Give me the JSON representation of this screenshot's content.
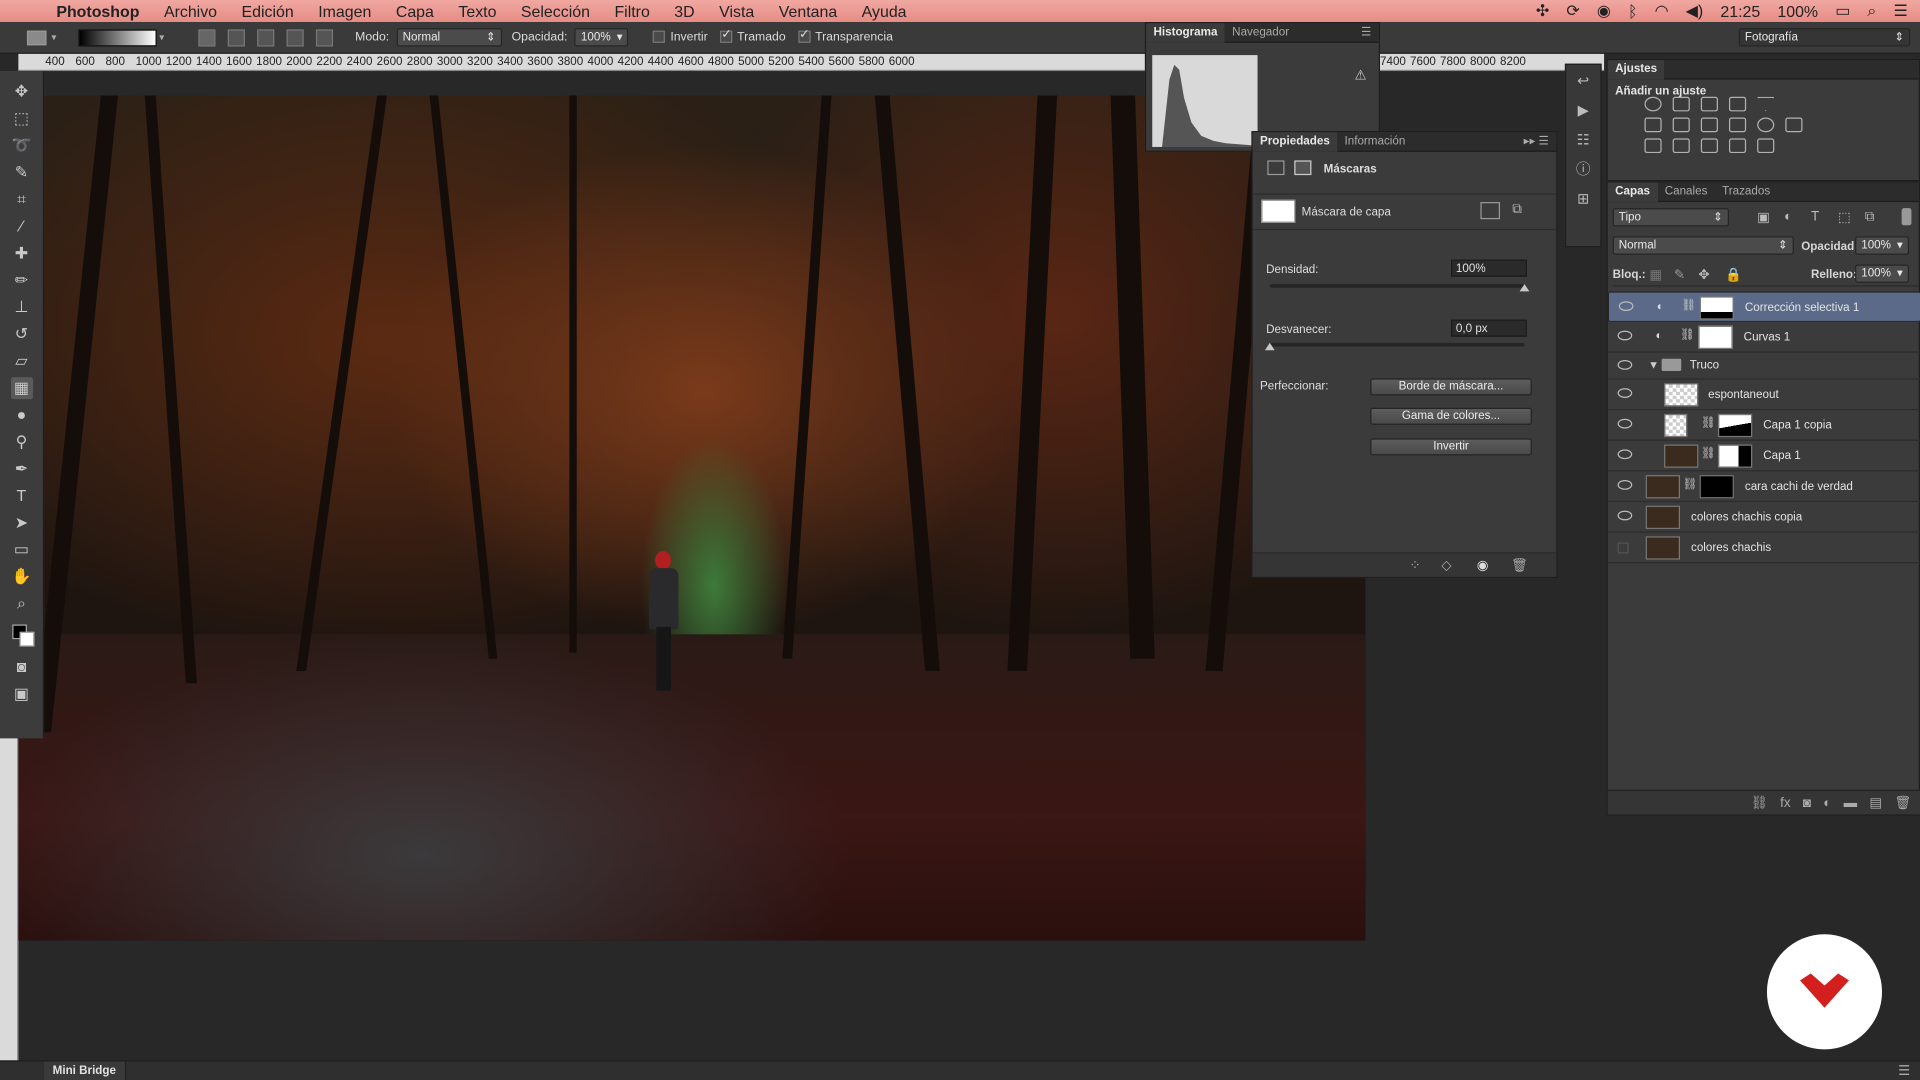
{
  "menubar": {
    "app": "Photoshop",
    "items": [
      "Archivo",
      "Edición",
      "Imagen",
      "Capa",
      "Texto",
      "Selección",
      "Filtro",
      "3D",
      "Vista",
      "Ventana",
      "Ayuda"
    ],
    "clock": "21:25",
    "battery": "100%"
  },
  "options": {
    "mode_label": "Modo:",
    "mode_value": "Normal",
    "opacity_label": "Opacidad:",
    "opacity_value": "100%",
    "invert_label": "Invertir",
    "dither_label": "Tramado",
    "transparency_label": "Transparencia",
    "workspace": "Fotografía"
  },
  "ruler_ticks": [
    "400",
    "600",
    "800",
    "1000",
    "1200",
    "1400",
    "1600",
    "1800",
    "2000",
    "2200",
    "2400",
    "2600",
    "2800",
    "3000",
    "3200",
    "3400",
    "3600",
    "3800",
    "4000",
    "4200",
    "4400",
    "4600",
    "4800",
    "5000",
    "5200",
    "5400",
    "5600",
    "5800",
    "6000"
  ],
  "ruler_ticks_right": [
    "7400",
    "7600",
    "7800",
    "8000",
    "8200"
  ],
  "histogram": {
    "tab_active": "Histograma",
    "tab_other": "Navegador"
  },
  "properties": {
    "tab_active": "Propiedades",
    "tab_other": "Información",
    "section": "Máscaras",
    "mask_type": "Máscara de capa",
    "density_label": "Densidad:",
    "density_value": "100%",
    "density_level": 1.0,
    "feather_label": "Desvanecer:",
    "feather_value": "0,0 px",
    "feather_level": 0.0,
    "refine_label": "Perfeccionar:",
    "btn_mask_edge": "Borde de máscara...",
    "btn_color_range": "Gama de colores...",
    "btn_invert": "Invertir"
  },
  "adjustments": {
    "title": "Ajustes",
    "subtitle": "Añadir un ajuste"
  },
  "layers": {
    "tabs": [
      "Capas",
      "Canales",
      "Trazados"
    ],
    "filter": "Tipo",
    "blend": "Normal",
    "opacity_label": "Opacidad:",
    "opacity_value": "100%",
    "lock_label": "Bloq.:",
    "fill_label": "Relleno:",
    "fill_value": "100%",
    "items": [
      {
        "name": "Corrección selectiva 1",
        "selected": true,
        "visible": true
      },
      {
        "name": "Curvas 1",
        "selected": false,
        "visible": true
      },
      {
        "name": "Truco",
        "selected": false,
        "visible": true
      },
      {
        "name": "espontaneout",
        "selected": false,
        "visible": true
      },
      {
        "name": "Capa 1 copia",
        "selected": false,
        "visible": true
      },
      {
        "name": "Capa 1",
        "selected": false,
        "visible": true
      },
      {
        "name": "cara cachi de verdad",
        "selected": false,
        "visible": true
      },
      {
        "name": "colores chachis copia",
        "selected": false,
        "visible": true
      },
      {
        "name": "colores chachis",
        "selected": false,
        "visible": false
      }
    ]
  },
  "bottom_tab": "Mini Bridge"
}
